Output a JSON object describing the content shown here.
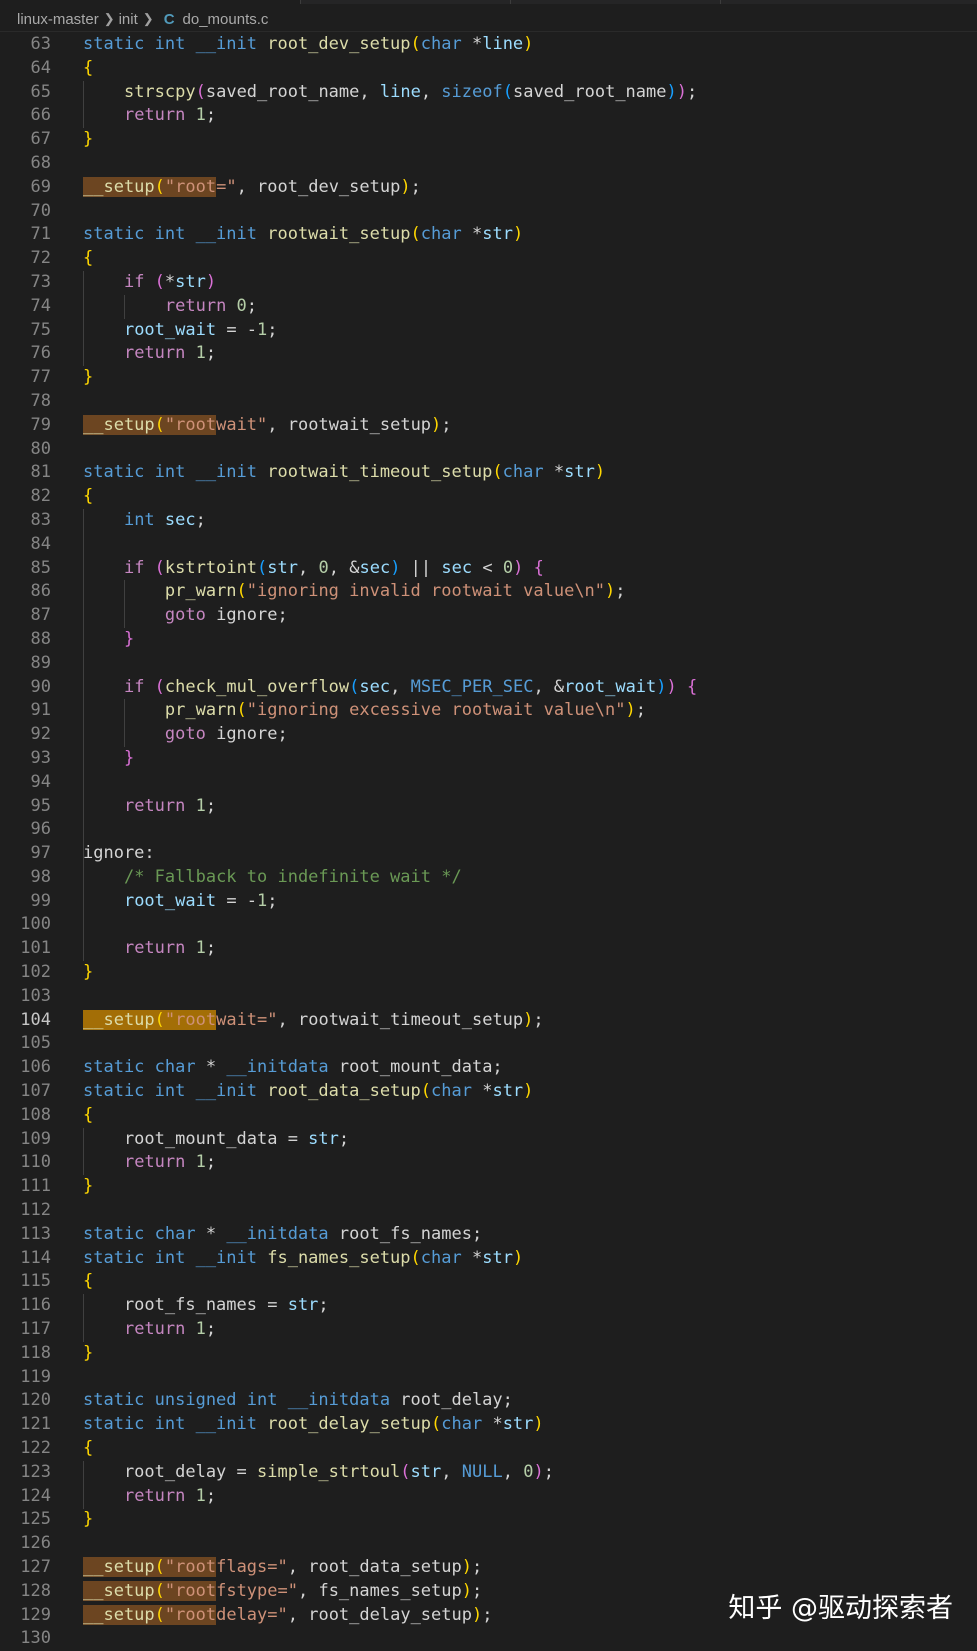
{
  "breadcrumb": {
    "project": "linux-master",
    "folder": "init",
    "file_icon": "C",
    "file": "do_mounts.c"
  },
  "current_line": 104,
  "colors": {
    "background": "#1e1e1e",
    "line_number": "#858585",
    "keyword": "#569cd6",
    "control": "#c586c0",
    "function": "#dcdcaa",
    "string": "#ce9178",
    "number": "#b5cea8",
    "variable": "#9cdcfe",
    "comment": "#6a9955",
    "match_highlight": "#ad6624"
  },
  "watermark": "知乎 @驱动探索者",
  "lines": [
    {
      "n": 63,
      "t": [
        [
          "static int __init ",
          "kw"
        ],
        [
          "root_dev_setup",
          "fn"
        ],
        [
          "(",
          "b1"
        ],
        [
          "char ",
          "kw"
        ],
        [
          "*",
          "tx"
        ],
        [
          "line",
          "var"
        ],
        [
          ")",
          "b1"
        ]
      ]
    },
    {
      "n": 64,
      "t": [
        [
          "{",
          "b1"
        ]
      ]
    },
    {
      "n": 65,
      "t": [
        [
          "    ",
          "tx"
        ],
        [
          "strscpy",
          "fn"
        ],
        [
          "(",
          "b2"
        ],
        [
          "saved_root_name, ",
          "tx"
        ],
        [
          "line",
          "var"
        ],
        [
          ", ",
          "tx"
        ],
        [
          "sizeof",
          "kw"
        ],
        [
          "(",
          "b3"
        ],
        [
          "saved_root_name",
          "tx"
        ],
        [
          ")",
          "b3"
        ],
        [
          ")",
          "b2"
        ],
        [
          ";",
          "tx"
        ]
      ]
    },
    {
      "n": 66,
      "t": [
        [
          "    ",
          "tx"
        ],
        [
          "return ",
          "ctl"
        ],
        [
          "1",
          "num"
        ],
        [
          ";",
          "tx"
        ]
      ]
    },
    {
      "n": 67,
      "t": [
        [
          "}",
          "b1"
        ]
      ]
    },
    {
      "n": 68,
      "t": []
    },
    {
      "n": 69,
      "t": [
        [
          "__setup",
          "fn hl"
        ],
        [
          "(",
          "b1 hl"
        ],
        [
          "\"root",
          "str hl"
        ],
        [
          "=\"",
          "str"
        ],
        [
          ", root_dev_setup",
          "tx"
        ],
        [
          ")",
          "b1"
        ],
        [
          ";",
          "tx"
        ]
      ]
    },
    {
      "n": 70,
      "t": []
    },
    {
      "n": 71,
      "t": [
        [
          "static int __init ",
          "kw"
        ],
        [
          "rootwait_setup",
          "fn"
        ],
        [
          "(",
          "b1"
        ],
        [
          "char ",
          "kw"
        ],
        [
          "*",
          "tx"
        ],
        [
          "str",
          "var"
        ],
        [
          ")",
          "b1"
        ]
      ]
    },
    {
      "n": 72,
      "t": [
        [
          "{",
          "b1"
        ]
      ]
    },
    {
      "n": 73,
      "t": [
        [
          "    ",
          "tx"
        ],
        [
          "if ",
          "ctl"
        ],
        [
          "(",
          "b2"
        ],
        [
          "*",
          "tx"
        ],
        [
          "str",
          "var"
        ],
        [
          ")",
          "b2"
        ]
      ]
    },
    {
      "n": 74,
      "t": [
        [
          "        ",
          "tx"
        ],
        [
          "return ",
          "ctl"
        ],
        [
          "0",
          "num"
        ],
        [
          ";",
          "tx"
        ]
      ]
    },
    {
      "n": 75,
      "t": [
        [
          "    ",
          "tx"
        ],
        [
          "root_wait",
          "var"
        ],
        [
          " = -",
          "tx"
        ],
        [
          "1",
          "num"
        ],
        [
          ";",
          "tx"
        ]
      ]
    },
    {
      "n": 76,
      "t": [
        [
          "    ",
          "tx"
        ],
        [
          "return ",
          "ctl"
        ],
        [
          "1",
          "num"
        ],
        [
          ";",
          "tx"
        ]
      ]
    },
    {
      "n": 77,
      "t": [
        [
          "}",
          "b1"
        ]
      ]
    },
    {
      "n": 78,
      "t": []
    },
    {
      "n": 79,
      "t": [
        [
          "__setup",
          "fn hl"
        ],
        [
          "(",
          "b1 hl"
        ],
        [
          "\"root",
          "str hl"
        ],
        [
          "wait\"",
          "str"
        ],
        [
          ", rootwait_setup",
          "tx"
        ],
        [
          ")",
          "b1"
        ],
        [
          ";",
          "tx"
        ]
      ]
    },
    {
      "n": 80,
      "t": []
    },
    {
      "n": 81,
      "t": [
        [
          "static int __init ",
          "kw"
        ],
        [
          "rootwait_timeout_setup",
          "fn"
        ],
        [
          "(",
          "b1"
        ],
        [
          "char ",
          "kw"
        ],
        [
          "*",
          "tx"
        ],
        [
          "str",
          "var"
        ],
        [
          ")",
          "b1"
        ]
      ]
    },
    {
      "n": 82,
      "t": [
        [
          "{",
          "b1"
        ]
      ]
    },
    {
      "n": 83,
      "t": [
        [
          "    ",
          "tx"
        ],
        [
          "int ",
          "kw"
        ],
        [
          "sec",
          "var"
        ],
        [
          ";",
          "tx"
        ]
      ]
    },
    {
      "n": 84,
      "t": []
    },
    {
      "n": 85,
      "t": [
        [
          "    ",
          "tx"
        ],
        [
          "if ",
          "ctl"
        ],
        [
          "(",
          "b2"
        ],
        [
          "kstrtoint",
          "fn"
        ],
        [
          "(",
          "b3"
        ],
        [
          "str",
          "var"
        ],
        [
          ", ",
          "tx"
        ],
        [
          "0",
          "num"
        ],
        [
          ", &",
          "tx"
        ],
        [
          "sec",
          "var"
        ],
        [
          ")",
          "b3"
        ],
        [
          " || ",
          "tx"
        ],
        [
          "sec",
          "var"
        ],
        [
          " < ",
          "tx"
        ],
        [
          "0",
          "num"
        ],
        [
          ")",
          "b2"
        ],
        [
          " {",
          "b2"
        ]
      ]
    },
    {
      "n": 86,
      "t": [
        [
          "        ",
          "tx"
        ],
        [
          "pr_warn",
          "fn"
        ],
        [
          "(",
          "b1"
        ],
        [
          "\"ignoring invalid rootwait value\\n\"",
          "str"
        ],
        [
          ")",
          "b1"
        ],
        [
          ";",
          "tx"
        ]
      ]
    },
    {
      "n": 87,
      "t": [
        [
          "        ",
          "tx"
        ],
        [
          "goto ",
          "ctl"
        ],
        [
          "ignore;",
          "tx"
        ]
      ]
    },
    {
      "n": 88,
      "t": [
        [
          "    ",
          "tx"
        ],
        [
          "}",
          "b2"
        ]
      ]
    },
    {
      "n": 89,
      "t": []
    },
    {
      "n": 90,
      "t": [
        [
          "    ",
          "tx"
        ],
        [
          "if ",
          "ctl"
        ],
        [
          "(",
          "b2"
        ],
        [
          "check_mul_overflow",
          "fn"
        ],
        [
          "(",
          "b3"
        ],
        [
          "sec",
          "var"
        ],
        [
          ", ",
          "tx"
        ],
        [
          "MSEC_PER_SEC",
          "mac"
        ],
        [
          ", &",
          "tx"
        ],
        [
          "root_wait",
          "var"
        ],
        [
          ")",
          "b3"
        ],
        [
          ")",
          "b2"
        ],
        [
          " {",
          "b2"
        ]
      ]
    },
    {
      "n": 91,
      "t": [
        [
          "        ",
          "tx"
        ],
        [
          "pr_warn",
          "fn"
        ],
        [
          "(",
          "b1"
        ],
        [
          "\"ignoring excessive rootwait value\\n\"",
          "str"
        ],
        [
          ")",
          "b1"
        ],
        [
          ";",
          "tx"
        ]
      ]
    },
    {
      "n": 92,
      "t": [
        [
          "        ",
          "tx"
        ],
        [
          "goto ",
          "ctl"
        ],
        [
          "ignore;",
          "tx"
        ]
      ]
    },
    {
      "n": 93,
      "t": [
        [
          "    ",
          "tx"
        ],
        [
          "}",
          "b2"
        ]
      ]
    },
    {
      "n": 94,
      "t": []
    },
    {
      "n": 95,
      "t": [
        [
          "    ",
          "tx"
        ],
        [
          "return ",
          "ctl"
        ],
        [
          "1",
          "num"
        ],
        [
          ";",
          "tx"
        ]
      ]
    },
    {
      "n": 96,
      "t": []
    },
    {
      "n": 97,
      "t": [
        [
          "ignore:",
          "tx"
        ]
      ]
    },
    {
      "n": 98,
      "t": [
        [
          "    ",
          "tx"
        ],
        [
          "/* Fallback to indefinite wait */",
          "cm"
        ]
      ]
    },
    {
      "n": 99,
      "t": [
        [
          "    ",
          "tx"
        ],
        [
          "root_wait",
          "var"
        ],
        [
          " = -",
          "tx"
        ],
        [
          "1",
          "num"
        ],
        [
          ";",
          "tx"
        ]
      ]
    },
    {
      "n": 100,
      "t": []
    },
    {
      "n": 101,
      "t": [
        [
          "    ",
          "tx"
        ],
        [
          "return ",
          "ctl"
        ],
        [
          "1",
          "num"
        ],
        [
          ";",
          "tx"
        ]
      ]
    },
    {
      "n": 102,
      "t": [
        [
          "}",
          "b1"
        ]
      ]
    },
    {
      "n": 103,
      "t": []
    },
    {
      "n": 104,
      "t": [
        [
          "__setup",
          "fn hl2"
        ],
        [
          "(",
          "b1 hl2"
        ],
        [
          "\"root",
          "str hl2"
        ],
        [
          "wait=\"",
          "str"
        ],
        [
          ", rootwait_timeout_setup",
          "tx"
        ],
        [
          ")",
          "b1"
        ],
        [
          ";",
          "tx"
        ]
      ]
    },
    {
      "n": 105,
      "t": []
    },
    {
      "n": 106,
      "t": [
        [
          "static char ",
          "kw"
        ],
        [
          "* ",
          "tx"
        ],
        [
          "__initdata ",
          "kw"
        ],
        [
          "root_mount_data;",
          "tx"
        ]
      ]
    },
    {
      "n": 107,
      "t": [
        [
          "static int __init ",
          "kw"
        ],
        [
          "root_data_setup",
          "fn"
        ],
        [
          "(",
          "b1"
        ],
        [
          "char ",
          "kw"
        ],
        [
          "*",
          "tx"
        ],
        [
          "str",
          "var"
        ],
        [
          ")",
          "b1"
        ]
      ]
    },
    {
      "n": 108,
      "t": [
        [
          "{",
          "b1"
        ]
      ]
    },
    {
      "n": 109,
      "t": [
        [
          "    root_mount_data = ",
          "tx"
        ],
        [
          "str",
          "var"
        ],
        [
          ";",
          "tx"
        ]
      ]
    },
    {
      "n": 110,
      "t": [
        [
          "    ",
          "tx"
        ],
        [
          "return ",
          "ctl"
        ],
        [
          "1",
          "num"
        ],
        [
          ";",
          "tx"
        ]
      ]
    },
    {
      "n": 111,
      "t": [
        [
          "}",
          "b1"
        ]
      ]
    },
    {
      "n": 112,
      "t": []
    },
    {
      "n": 113,
      "t": [
        [
          "static char ",
          "kw"
        ],
        [
          "* ",
          "tx"
        ],
        [
          "__initdata ",
          "kw"
        ],
        [
          "root_fs_names;",
          "tx"
        ]
      ]
    },
    {
      "n": 114,
      "t": [
        [
          "static int __init ",
          "kw"
        ],
        [
          "fs_names_setup",
          "fn"
        ],
        [
          "(",
          "b1"
        ],
        [
          "char ",
          "kw"
        ],
        [
          "*",
          "tx"
        ],
        [
          "str",
          "var"
        ],
        [
          ")",
          "b1"
        ]
      ]
    },
    {
      "n": 115,
      "t": [
        [
          "{",
          "b1"
        ]
      ]
    },
    {
      "n": 116,
      "t": [
        [
          "    root_fs_names = ",
          "tx"
        ],
        [
          "str",
          "var"
        ],
        [
          ";",
          "tx"
        ]
      ]
    },
    {
      "n": 117,
      "t": [
        [
          "    ",
          "tx"
        ],
        [
          "return ",
          "ctl"
        ],
        [
          "1",
          "num"
        ],
        [
          ";",
          "tx"
        ]
      ]
    },
    {
      "n": 118,
      "t": [
        [
          "}",
          "b1"
        ]
      ]
    },
    {
      "n": 119,
      "t": []
    },
    {
      "n": 120,
      "t": [
        [
          "static unsigned int ",
          "kw"
        ],
        [
          "__initdata ",
          "kw"
        ],
        [
          "root_delay;",
          "tx"
        ]
      ]
    },
    {
      "n": 121,
      "t": [
        [
          "static int __init ",
          "kw"
        ],
        [
          "root_delay_setup",
          "fn"
        ],
        [
          "(",
          "b1"
        ],
        [
          "char ",
          "kw"
        ],
        [
          "*",
          "tx"
        ],
        [
          "str",
          "var"
        ],
        [
          ")",
          "b1"
        ]
      ]
    },
    {
      "n": 122,
      "t": [
        [
          "{",
          "b1"
        ]
      ]
    },
    {
      "n": 123,
      "t": [
        [
          "    root_delay = ",
          "tx"
        ],
        [
          "simple_strtoul",
          "fn"
        ],
        [
          "(",
          "b2"
        ],
        [
          "str",
          "var"
        ],
        [
          ", ",
          "tx"
        ],
        [
          "NULL",
          "kw"
        ],
        [
          ", ",
          "tx"
        ],
        [
          "0",
          "num"
        ],
        [
          ")",
          "b2"
        ],
        [
          ";",
          "tx"
        ]
      ]
    },
    {
      "n": 124,
      "t": [
        [
          "    ",
          "tx"
        ],
        [
          "return ",
          "ctl"
        ],
        [
          "1",
          "num"
        ],
        [
          ";",
          "tx"
        ]
      ]
    },
    {
      "n": 125,
      "t": [
        [
          "}",
          "b1"
        ]
      ]
    },
    {
      "n": 126,
      "t": []
    },
    {
      "n": 127,
      "t": [
        [
          "__setup",
          "fn hl"
        ],
        [
          "(",
          "b1 hl"
        ],
        [
          "\"root",
          "str hl"
        ],
        [
          "flags=\"",
          "str"
        ],
        [
          ", root_data_setup",
          "tx"
        ],
        [
          ")",
          "b1"
        ],
        [
          ";",
          "tx"
        ]
      ]
    },
    {
      "n": 128,
      "t": [
        [
          "__setup",
          "fn hl"
        ],
        [
          "(",
          "b1 hl"
        ],
        [
          "\"root",
          "str hl"
        ],
        [
          "fstype=\"",
          "str"
        ],
        [
          ", fs_names_setup",
          "tx"
        ],
        [
          ")",
          "b1"
        ],
        [
          ";",
          "tx"
        ]
      ]
    },
    {
      "n": 129,
      "t": [
        [
          "__setup",
          "fn hl"
        ],
        [
          "(",
          "b1 hl"
        ],
        [
          "\"root",
          "str hl"
        ],
        [
          "delay=\"",
          "str"
        ],
        [
          ", root_delay_setup",
          "tx"
        ],
        [
          ")",
          "b1"
        ],
        [
          ";",
          "tx"
        ]
      ]
    },
    {
      "n": 130,
      "t": []
    }
  ]
}
